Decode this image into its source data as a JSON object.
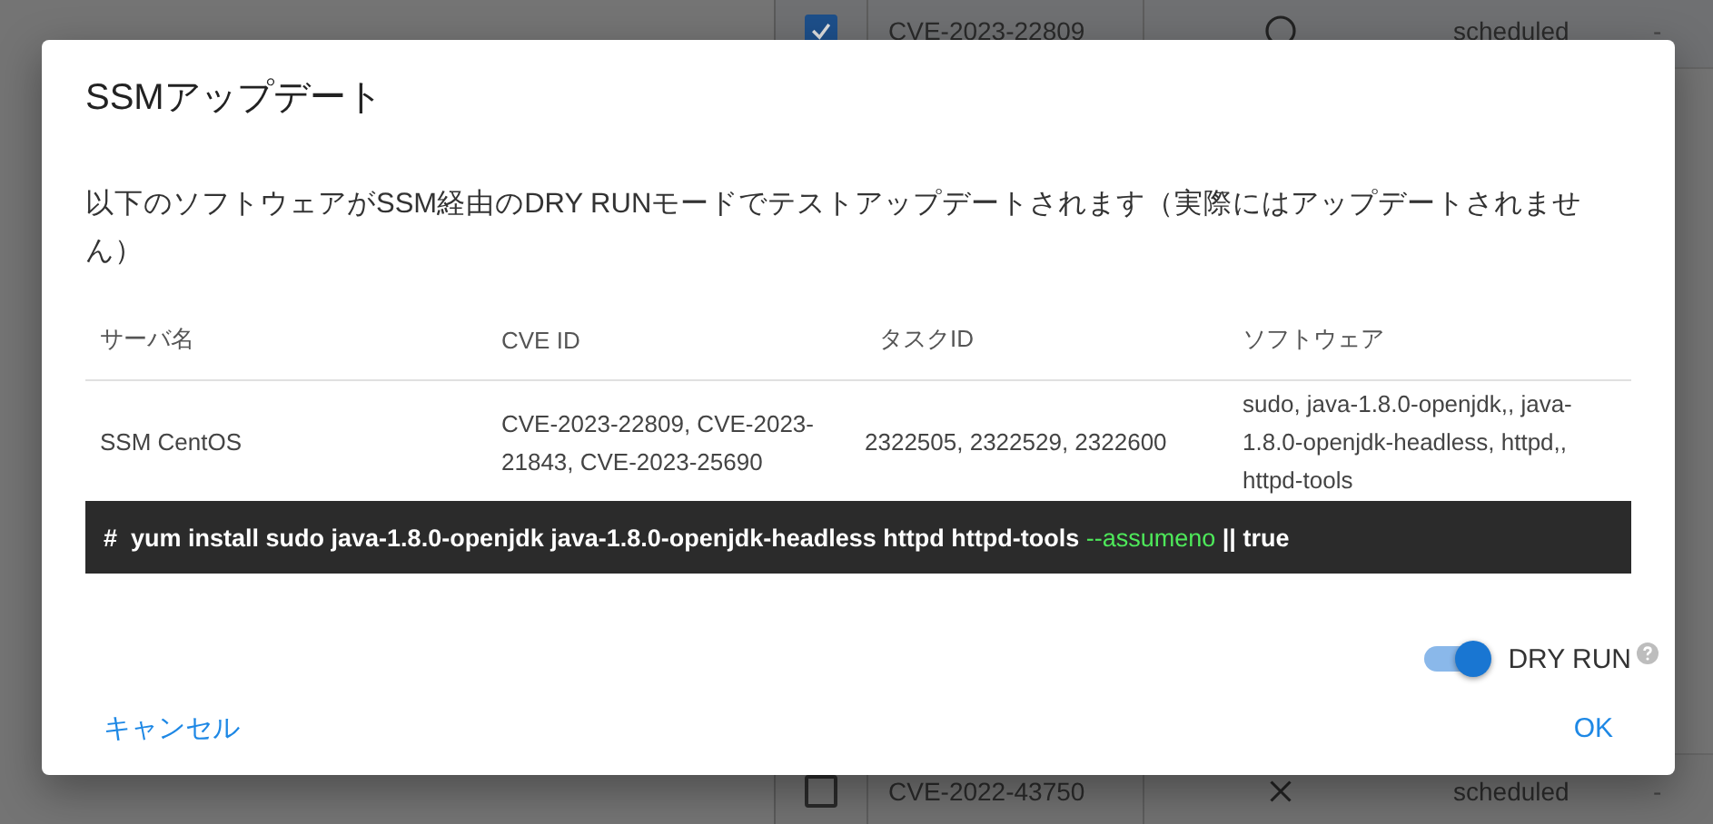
{
  "background_table": {
    "rows": [
      {
        "checked": true,
        "cve": "CVE-2023-22809",
        "kind": "circle",
        "status": "scheduled",
        "column_5": "-"
      },
      {
        "checked": false,
        "cve": "CVE-2022-43750",
        "kind": "cross",
        "status": "scheduled",
        "column_5": "-"
      }
    ]
  },
  "dialog": {
    "title": "SSMアップデート",
    "message": "以下のソフトウェアがSSM経由のDRY RUNモードでテストアップデートされます（実際にはアップデートされません）",
    "table": {
      "columns": [
        "サーバ名",
        "CVE ID",
        "タスクID",
        "ソフトウェア"
      ],
      "rows": [
        [
          "SSM CentOS",
          "CVE-2023-22809, CVE-2023-21843, CVE-2023-25690",
          "2322505, 2322529, 2322600",
          "sudo, java-1.8.0-openjdk,, java-1.8.0-openjdk-headless, httpd,, httpd-tools"
        ]
      ]
    },
    "command": [
      {
        "kind": "plain",
        "text": "#  yum install sudo java-1.8.0-openjdk java-1.8.0-openjdk-headless httpd httpd-tools "
      },
      {
        "kind": "option",
        "text": "--assumeno"
      },
      {
        "kind": "plain",
        "text": " || true"
      }
    ],
    "dry_run": {
      "label": "DRY RUN",
      "on": true
    },
    "buttons": {
      "cancel": "キャンセル",
      "ok": "OK"
    }
  }
}
